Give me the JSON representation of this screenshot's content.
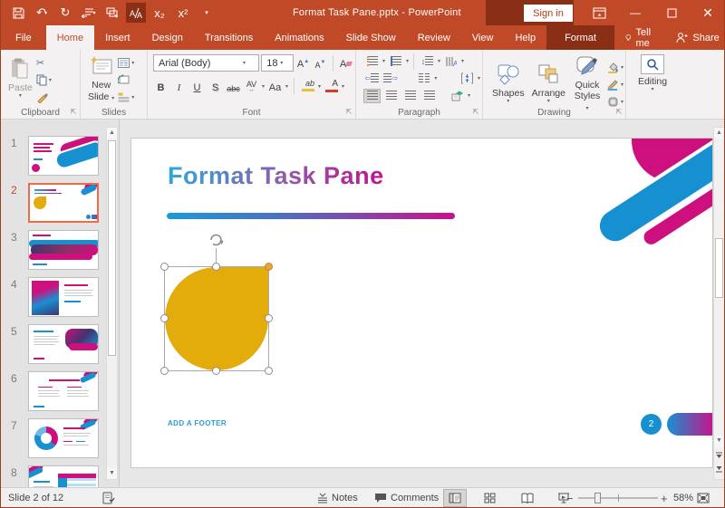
{
  "colors": {
    "titlebar": "#C04A28",
    "contextual_dark": "#8A2F16",
    "ribbon_bg": "#F3F1F1",
    "accent_blue": "#1790D2",
    "accent_pink": "#CE0F7E",
    "shape_yellow": "#E3AC0B",
    "selection_orange": "#ED6C47"
  },
  "titlebar": {
    "title": "Format Task Pane.pptx  -  PowerPoint",
    "sign_in_label": "Sign in",
    "subscript_glyph": "x₂",
    "superscript_glyph": "x²"
  },
  "tabs": {
    "file": "File",
    "home": "Home",
    "insert": "Insert",
    "design": "Design",
    "transitions": "Transitions",
    "animations": "Animations",
    "slide_show": "Slide Show",
    "review": "Review",
    "view": "View",
    "help": "Help",
    "format": "Format",
    "tell_me": "Tell me",
    "share": "Share"
  },
  "ribbon": {
    "clipboard": {
      "group_label": "Clipboard",
      "paste_label": "Paste"
    },
    "slides": {
      "group_label": "Slides",
      "new_label": "New",
      "slide_label": "Slide"
    },
    "font": {
      "group_label": "Font",
      "font_name": "Arial (Body)",
      "font_size": "18",
      "bold": "B",
      "italic": "I",
      "underline": "U",
      "shadow": "S",
      "strike": "abc",
      "spacing": "AV",
      "case": "Aa",
      "highlight": "ab",
      "color": "A"
    },
    "paragraph": {
      "group_label": "Paragraph"
    },
    "drawing": {
      "group_label": "Drawing",
      "shapes_label": "Shapes",
      "arrange_label": "Arrange",
      "quick_label": "Quick",
      "styles_label": "Styles"
    },
    "editing": {
      "label": "Editing"
    }
  },
  "thumbnails": {
    "selected": "2",
    "items": [
      {
        "number": "1"
      },
      {
        "number": "2"
      },
      {
        "number": "3"
      },
      {
        "number": "4"
      },
      {
        "number": "5"
      },
      {
        "number": "6"
      },
      {
        "number": "7"
      },
      {
        "number": "8"
      }
    ]
  },
  "slide": {
    "title": "Format Task Pane",
    "footer_placeholder": "ADD A FOOTER",
    "page_number": "2"
  },
  "statusbar": {
    "slide_indicator": "Slide 2 of 12",
    "notes_label": "Notes",
    "comments_label": "Comments",
    "zoom_level": "58%"
  }
}
